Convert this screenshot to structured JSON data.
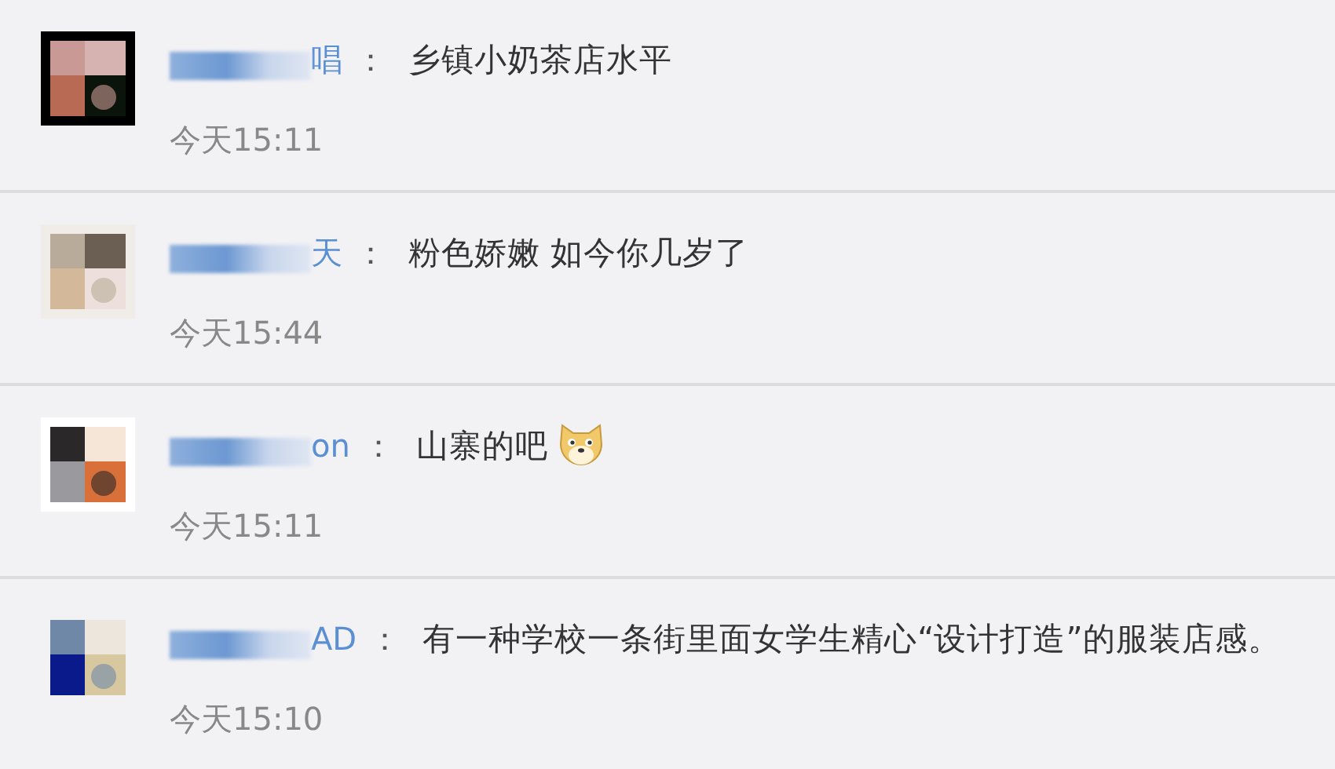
{
  "comments": [
    {
      "name": "唱",
      "separator": "：",
      "text": "乡镇小奶茶店水平",
      "has_emoji": false,
      "time": "今天15:11"
    },
    {
      "name": "天",
      "separator": "：",
      "text": "粉色娇嫩 如今你几岁了",
      "has_emoji": false,
      "time": "今天15:44"
    },
    {
      "name": "on",
      "separator": "：",
      "text": "山寨的吧",
      "has_emoji": true,
      "time": "今天15:11"
    },
    {
      "name": "AD",
      "separator": "：",
      "text": "有一种学校一条街里面女学生精心“设计打造”的服装店感。",
      "has_emoji": false,
      "time": "今天15:10"
    }
  ]
}
